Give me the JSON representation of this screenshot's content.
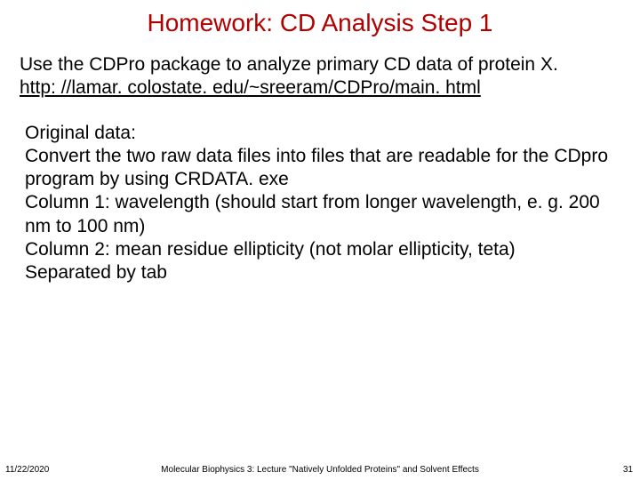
{
  "title": "Homework: CD Analysis Step 1",
  "intro": {
    "line1": "Use the CDPro package to analyze primary CD data of protein X.",
    "link": "http: //lamar. colostate. edu/~sreeram/CDPro/main. html"
  },
  "details": {
    "h": "Original data:",
    "l1": "Convert the two raw data files into files that are readable for the CDpro program by using CRDATA. exe",
    "l2": "Column 1: wavelength (should start from longer wavelength, e. g. 200 nm to 100 nm)",
    "l3": "Column 2: mean residue ellipticity (not molar ellipticity, teta)",
    "l4": "Separated by tab"
  },
  "footer": {
    "date": "11/22/2020",
    "center": "Molecular Biophysics 3: Lecture \"Natively Unfolded Proteins\" and Solvent Effects",
    "page": "31"
  }
}
